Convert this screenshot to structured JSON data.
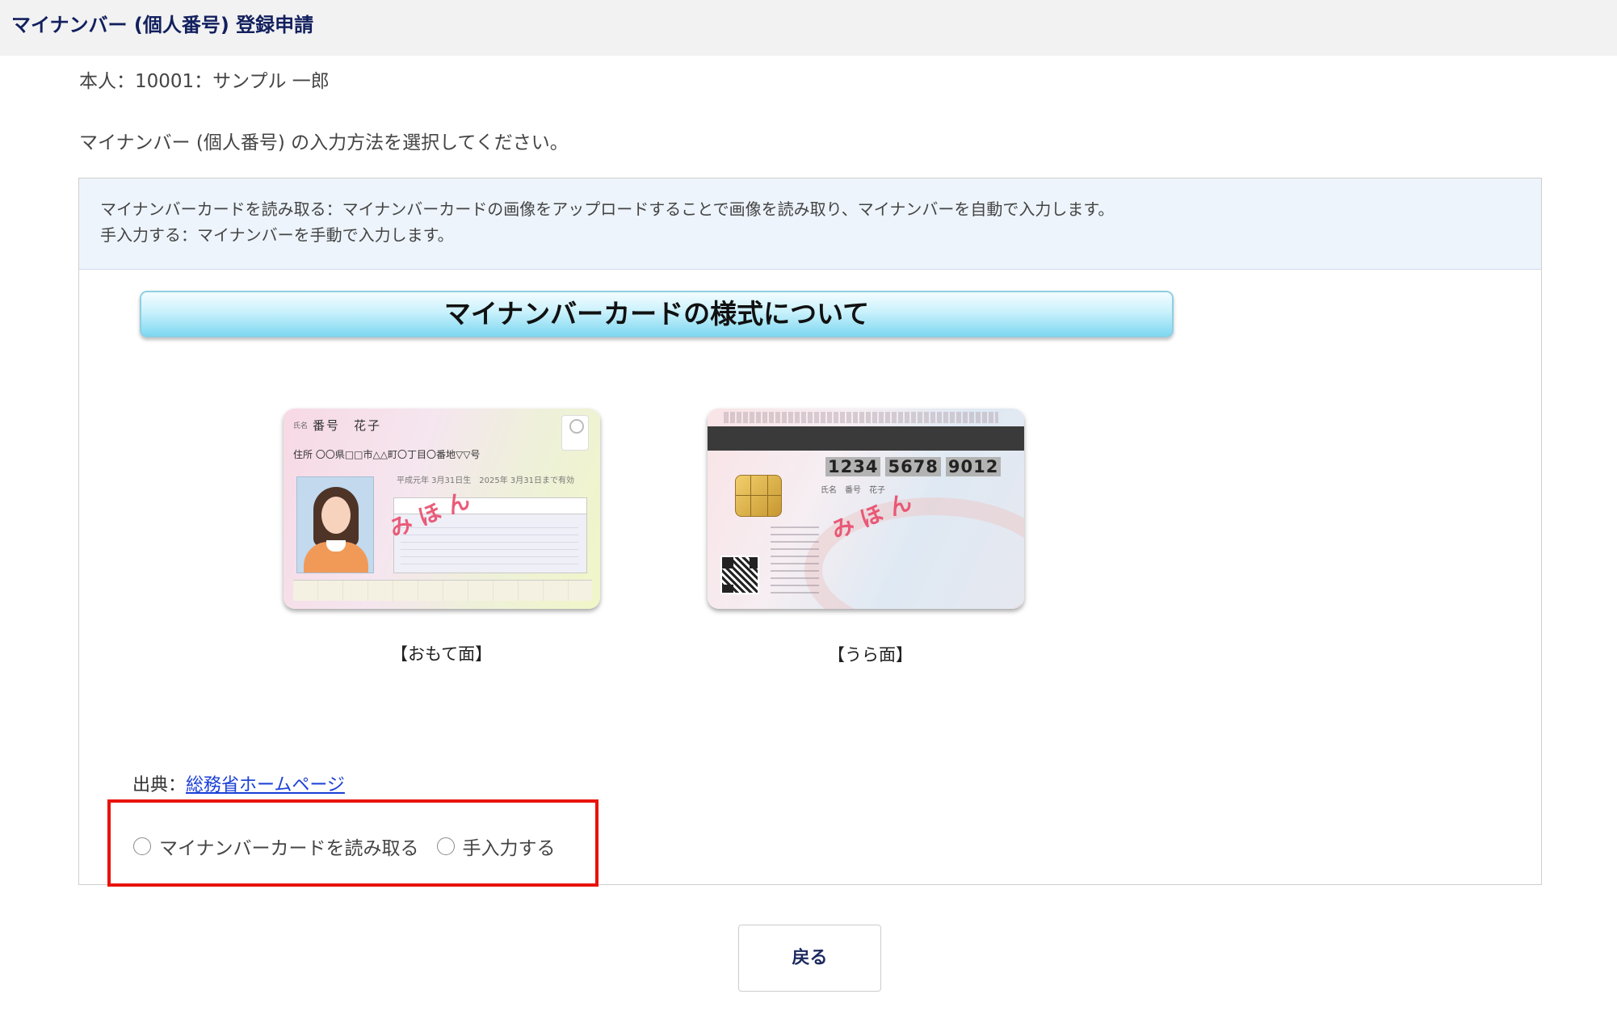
{
  "header": {
    "title": "マイナンバー (個人番号) 登録申請"
  },
  "person_line": "本人：10001：サンプル 一郎",
  "instruction": "マイナンバー (個人番号) の入力方法を選択してください。",
  "info": {
    "line1": "マイナンバーカードを読み取る：マイナンバーカードの画像をアップロードすることで画像を読み取り、マイナンバーを自動で入力します。",
    "line2": "手入力する：マイナンバーを手動で入力します。"
  },
  "card_image": {
    "banner": "マイナンバーカードの様式について",
    "front": {
      "caption": "【おもて面】",
      "name_label": "氏名",
      "name": "番号　花子",
      "address_label": "住所",
      "address": "〇〇県□□市△△町〇丁目〇番地▽▽号",
      "dob": "平成元年 3月31日生　2025年 3月31日まで有効",
      "stamp": "みほん"
    },
    "back": {
      "caption": "【うら面】",
      "number": [
        "1234",
        "5678",
        "9012"
      ],
      "name": "氏名　番号　花子",
      "stamp": "みほん"
    }
  },
  "source": {
    "label": "出典：",
    "link_text": "総務省ホームページ"
  },
  "options": [
    {
      "label": "マイナンバーカードを読み取る",
      "selected": false
    },
    {
      "label": "手入力する",
      "selected": false
    }
  ],
  "buttons": {
    "back": "戻る"
  },
  "colors": {
    "title": "#12205e",
    "highlight_border": "#e8120b",
    "link": "#1a3fd6",
    "info_bg": "#edf4fb"
  }
}
